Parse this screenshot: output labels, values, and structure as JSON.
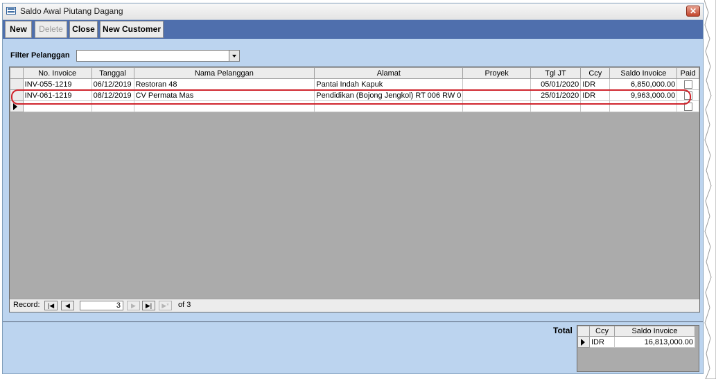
{
  "window": {
    "title": "Saldo Awal Piutang Dagang",
    "close_glyph": "✕"
  },
  "toolbar": {
    "new": "New",
    "delete": "Delete",
    "close": "Close",
    "new_customer": "New Customer"
  },
  "filter": {
    "label": "Filter Pelanggan",
    "value": ""
  },
  "grid": {
    "columns": [
      "No. Invoice",
      "Tanggal",
      "Nama Pelanggan",
      "Alamat",
      "Proyek",
      "Tgl JT",
      "Ccy",
      "Saldo Invoice",
      "Paid"
    ],
    "rows": [
      {
        "invoice": "INV-055-1219",
        "tanggal": "06/12/2019",
        "nama": "Restoran 48",
        "alamat": "Pantai Indah Kapuk",
        "proyek": "",
        "tgl_jt": "05/01/2020",
        "ccy": "IDR",
        "saldo": "6,850,000.00",
        "paid": false
      },
      {
        "invoice": "INV-061-1219",
        "tanggal": "08/12/2019",
        "nama": "CV Permata Mas",
        "alamat": "Pendidikan (Bojong Jengkol) RT 006 RW 0",
        "proyek": "",
        "tgl_jt": "25/01/2020",
        "ccy": "IDR",
        "saldo": "9,963,000.00",
        "paid": false
      }
    ]
  },
  "navigator": {
    "label": "Record:",
    "current": "3",
    "of_text": "of 3"
  },
  "total": {
    "label": "Total",
    "columns": [
      "Ccy",
      "Saldo Invoice"
    ],
    "rows": [
      {
        "ccy": "IDR",
        "saldo": "16,813,000.00"
      }
    ]
  },
  "colors": {
    "highlight": "#d0252d",
    "toolbar": "#4f6fad",
    "form_bg": "#bcd4ef"
  }
}
